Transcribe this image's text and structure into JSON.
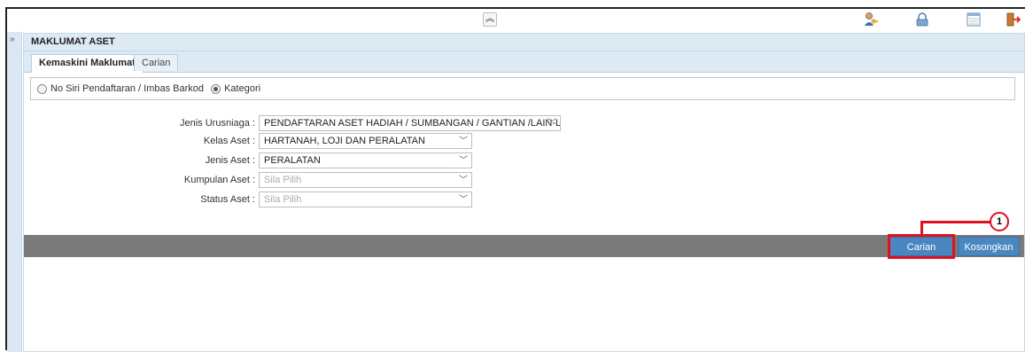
{
  "panel": {
    "title": "MAKLUMAT ASET"
  },
  "tabs": [
    {
      "label": "Kemaskini Maklumat",
      "active": true
    },
    {
      "label": "Carian",
      "active": false
    }
  ],
  "search_mode": {
    "options": [
      {
        "label": "No Siri Pendaftaran / Imbas Barkod",
        "checked": false
      },
      {
        "label": "Kategori",
        "checked": true
      }
    ]
  },
  "form": {
    "jenis_urusniaga": {
      "label": "Jenis Urusniaga :",
      "value": "PENDAFTARAN ASET HADIAH / SUMBANGAN / GANTIAN /LAIN-LA"
    },
    "kelas_aset": {
      "label": "Kelas Aset :",
      "value": "HARTANAH, LOJI DAN PERALATAN"
    },
    "jenis_aset": {
      "label": "Jenis Aset :",
      "value": "PERALATAN"
    },
    "kumpulan_aset": {
      "label": "Kumpulan Aset :",
      "value": "Sila Pilih"
    },
    "status_aset": {
      "label": "Status Aset :",
      "value": "Sila Pilih"
    }
  },
  "actions": {
    "carian": "Carian",
    "kosongkan": "Kosongkan"
  },
  "callout": {
    "number": "1"
  },
  "icons": {
    "collapse": "chevron-double-up-icon",
    "sidebar_toggle": "chevron-double-right-icon",
    "user": "user-key-icon",
    "lock": "lock-icon",
    "calendar": "calendar-icon",
    "logout": "logout-icon"
  },
  "colors": {
    "accent": "#4a87c0",
    "header_bg": "#dde9f3",
    "action_bar": "#7b7b7b",
    "highlight": "#e0101e"
  }
}
